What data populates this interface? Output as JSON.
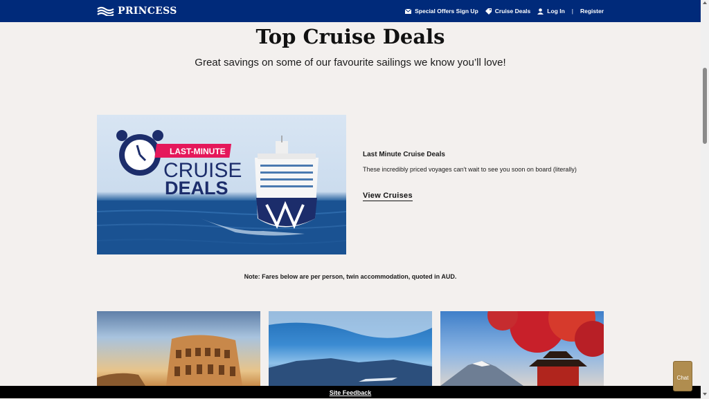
{
  "header": {
    "logo_text": "PRINCESS",
    "nav": {
      "offers_label": "Special Offers Sign Up",
      "deals_label": "Cruise Deals",
      "login_label": "Log In",
      "separator": "|",
      "register_label": "Register"
    }
  },
  "page": {
    "title": "Top Cruise Deals",
    "subtitle": "Great savings on some of our favourite sailings we know you’ll love!"
  },
  "promo": {
    "banner_top": "LAST-MINUTE",
    "banner_line1": "CRUISE",
    "banner_line2": "DEALS",
    "deal_title": "Last Minute Cruise Deals",
    "deal_description": "These incredibly priced voyages can't wait to see you soon on board (literally)",
    "view_link": "View Cruises"
  },
  "note": "Note: Fares below are per person, twin accommodation, quoted in AUD.",
  "cards": [
    {
      "icon": "colosseum-image"
    },
    {
      "icon": "mountain-lake-image"
    },
    {
      "icon": "mount-fuji-pagoda-image"
    }
  ],
  "footer": {
    "feedback_label": "Site Feedback"
  },
  "chat": {
    "label": "Chat"
  },
  "colors": {
    "nav_bg": "#002a7a",
    "page_bg": "#f3f0ee",
    "promo_pink": "#e5185b",
    "promo_navy": "#1c2d6b",
    "chat_gold": "#b08d4f"
  }
}
